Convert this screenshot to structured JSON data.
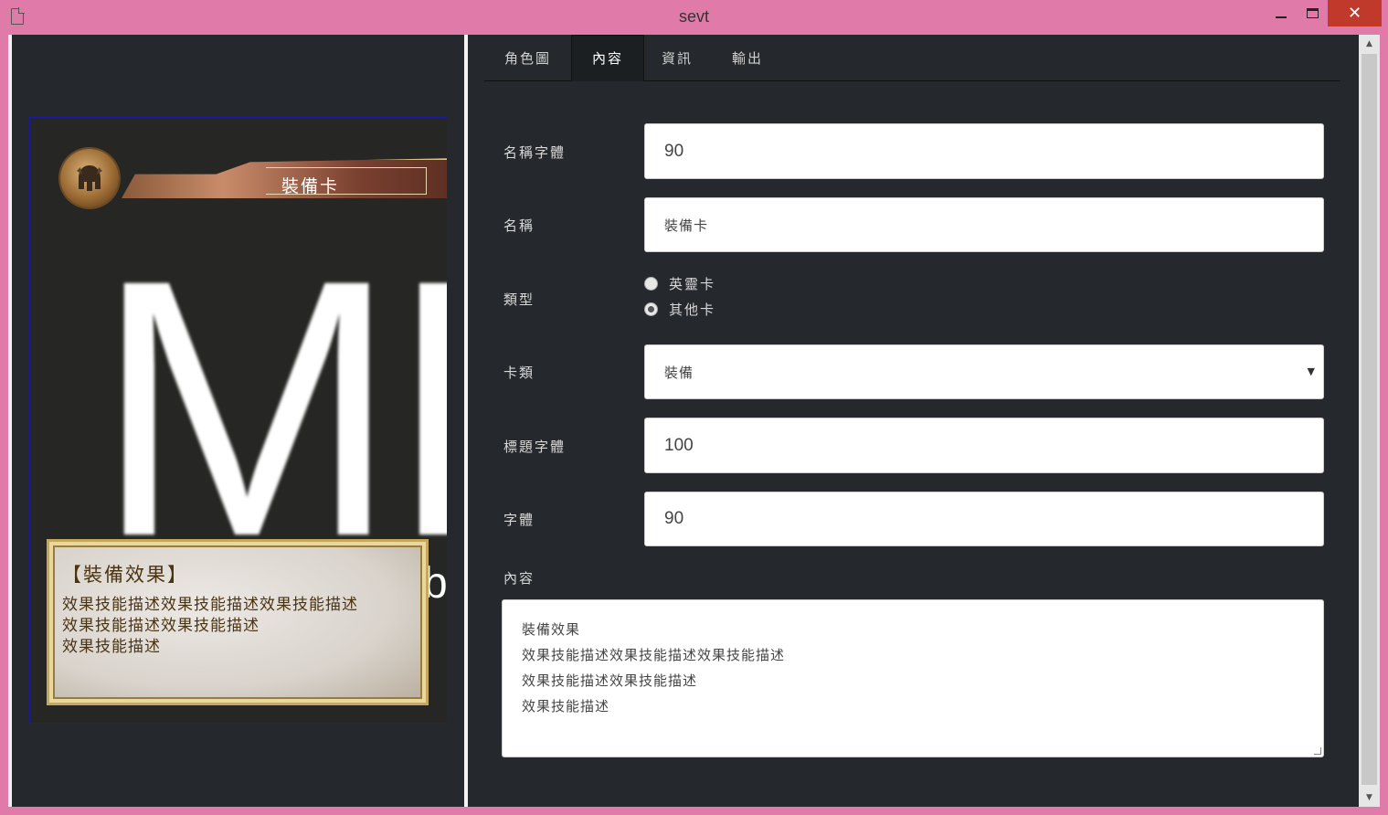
{
  "window": {
    "title": "sevt",
    "close_glyph": "✕",
    "icons": {
      "app": "document-icon",
      "minimize": "minimize-icon",
      "maximize": "maximize-icon",
      "close": "close-icon"
    }
  },
  "tabs": [
    {
      "label": "角色圖",
      "active": false
    },
    {
      "label": "內容",
      "active": true
    },
    {
      "label": "資訊",
      "active": false
    },
    {
      "label": "輸出",
      "active": false
    }
  ],
  "card_preview": {
    "name": "裝備卡",
    "background_text": "MP",
    "background_small": "b",
    "emblem_icon": "helmet-icon",
    "effect_title": "【裝備效果】",
    "effect_lines": [
      "效果技能描述效果技能描述效果技能描述",
      "效果技能描述效果技能描述",
      "效果技能描述"
    ]
  },
  "form": {
    "name_font": {
      "label": "名稱字體",
      "value": "90"
    },
    "name": {
      "label": "名稱",
      "value": "裝備卡"
    },
    "type": {
      "label": "類型",
      "options": [
        {
          "label": "英靈卡",
          "checked": false
        },
        {
          "label": "其他卡",
          "checked": true
        }
      ]
    },
    "card_category": {
      "label": "卡類",
      "value": "裝備"
    },
    "title_font": {
      "label": "標題字體",
      "value": "100"
    },
    "font": {
      "label": "字體",
      "value": "90"
    },
    "content": {
      "label": "內容",
      "lines": [
        "裝備效果",
        "效果技能描述效果技能描述效果技能描述",
        "效果技能描述效果技能描述",
        "效果技能描述"
      ]
    }
  },
  "colors": {
    "titlebar": "#e07aa8",
    "background": "#25282c",
    "close_button": "#c0392b"
  }
}
